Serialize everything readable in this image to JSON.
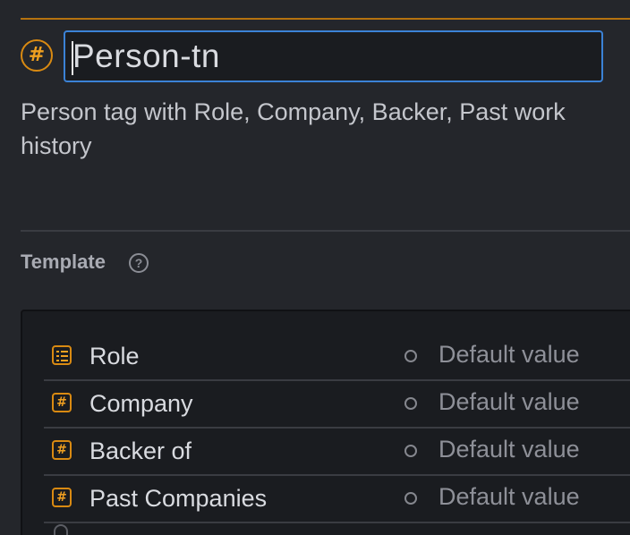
{
  "tag": {
    "icon": "hash-circle-icon",
    "title_value": "Person-tn",
    "description": "Person tag with Role, Company, Backer, Past work history"
  },
  "template": {
    "label": "Template",
    "help_icon": "question-circle-icon",
    "fields": [
      {
        "name": "Role",
        "icon": "list-icon",
        "default_placeholder": "Default value"
      },
      {
        "name": "Company",
        "icon": "hash-square-icon",
        "default_placeholder": "Default value"
      },
      {
        "name": "Backer of",
        "icon": "hash-square-icon",
        "default_placeholder": "Default value"
      },
      {
        "name": "Past Companies",
        "icon": "hash-square-icon",
        "default_placeholder": "Default value"
      }
    ]
  },
  "colors": {
    "accent": "#d98a12",
    "focus_border": "#3b82d6",
    "background": "#24262b",
    "panel": "#1a1c20"
  }
}
